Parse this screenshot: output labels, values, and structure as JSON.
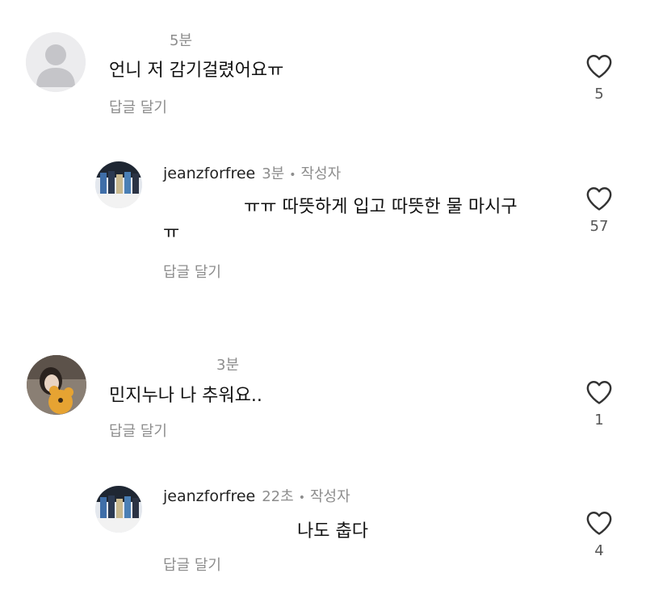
{
  "comments": [
    {
      "time": "5분",
      "text": "언니 저 감기걸렸어요ㅠ",
      "reply_label": "답글 달기",
      "likes": "5",
      "replies": [
        {
          "username": "jeanzforfree",
          "time": "3분",
          "author_badge": "작성자",
          "text_line1": "ㅠㅠ 따뜻하게 입고 따뜻한 물 마시구",
          "text_line2": "ㅠ",
          "reply_label": "답글 달기",
          "likes": "57"
        }
      ]
    },
    {
      "time": "3분",
      "text": "민지누나 나 추워요..",
      "reply_label": "답글 달기",
      "likes": "1",
      "replies": [
        {
          "username": "jeanzforfree",
          "time": "22초",
          "author_badge": "작성자",
          "text_line1": "나도 춥다",
          "reply_label": "답글 달기",
          "likes": "4"
        }
      ]
    }
  ],
  "icons": {
    "like": "heart-outline-icon",
    "default_avatar": "person-silhouette-icon"
  },
  "colors": {
    "text": "#111111",
    "muted": "#8d8d8d",
    "avatar_bg": "#e9e9ec"
  }
}
